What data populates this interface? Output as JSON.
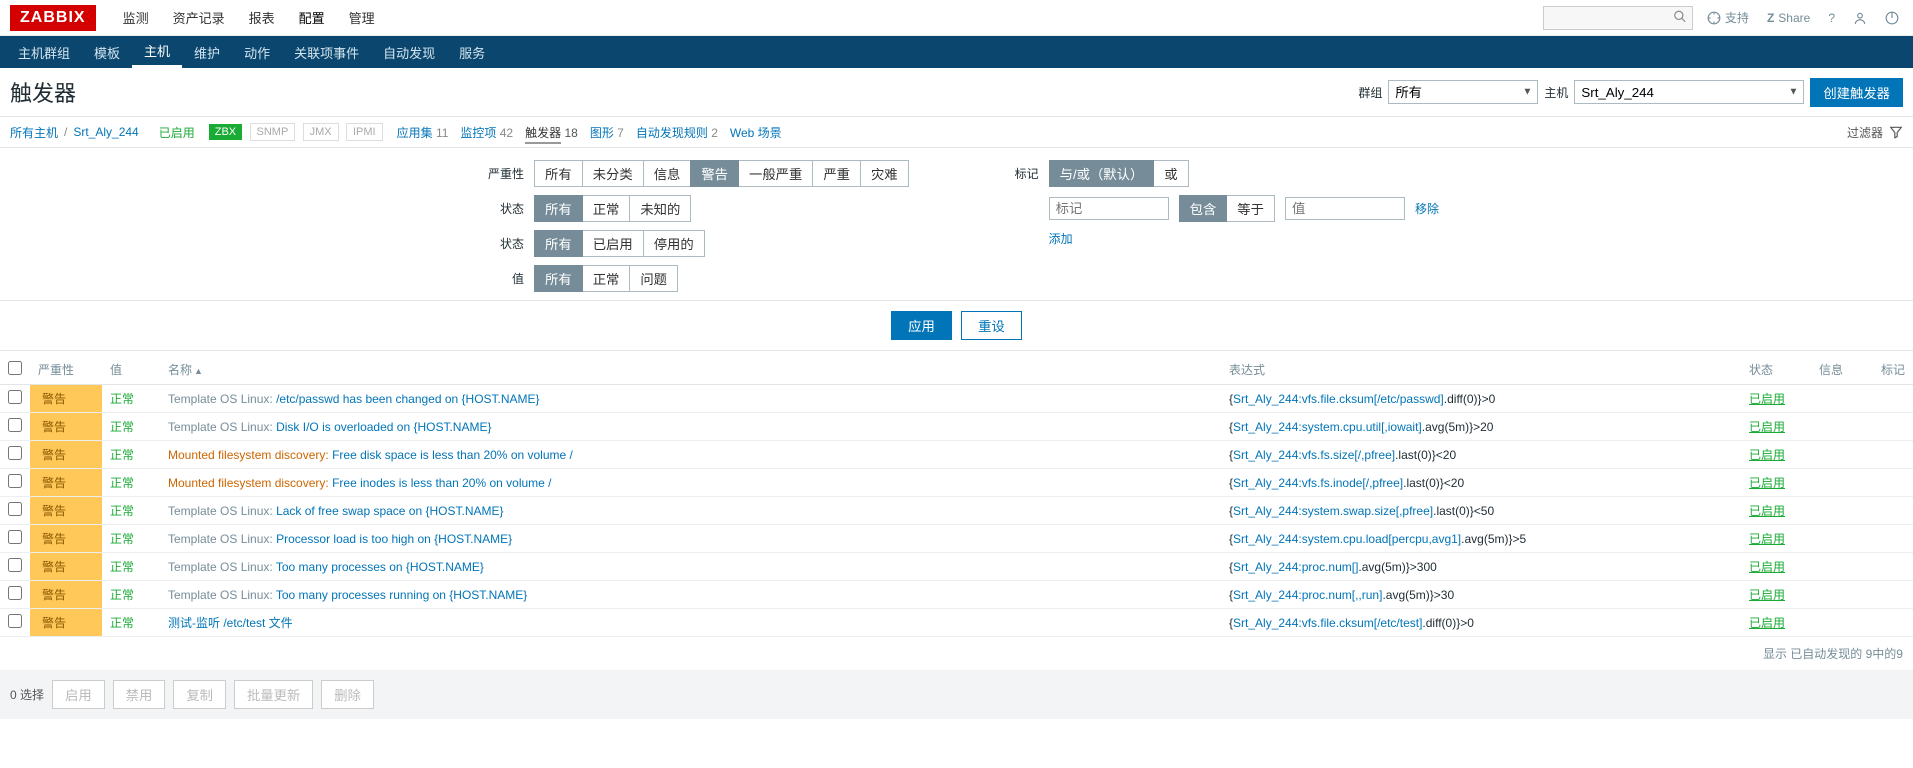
{
  "header": {
    "logo": "ZABBIX",
    "menu": [
      "监测",
      "资产记录",
      "报表",
      "配置",
      "管理"
    ],
    "menu_active_index": 3,
    "support": "支持",
    "share": "Share"
  },
  "subnav": {
    "items": [
      "主机群组",
      "模板",
      "主机",
      "维护",
      "动作",
      "关联项事件",
      "自动发现",
      "服务"
    ],
    "active_index": 2
  },
  "title": {
    "text": "触发器",
    "group_label": "群组",
    "group_value": "所有",
    "host_label": "主机",
    "host_value": "Srt_Aly_244",
    "create_btn": "创建触发器"
  },
  "crumb": {
    "all_hosts": "所有主机",
    "host": "Srt_Aly_244",
    "enabled": "已启用",
    "zbx": "ZBX",
    "snmp": "SNMP",
    "jmx": "JMX",
    "ipmi": "IPMI",
    "items": [
      {
        "label": "应用集",
        "count": "11"
      },
      {
        "label": "监控项",
        "count": "42"
      },
      {
        "label": "触发器",
        "count": "18",
        "active": true
      },
      {
        "label": "图形",
        "count": "7"
      },
      {
        "label": "自动发现规则",
        "count": "2"
      },
      {
        "label": "Web 场景",
        "count": ""
      }
    ],
    "filter_label": "过滤器"
  },
  "filter": {
    "labels": {
      "severity": "严重性",
      "state": "状态",
      "state2": "状态",
      "value": "值",
      "tags": "标记"
    },
    "severity_opts": [
      "所有",
      "未分类",
      "信息",
      "警告",
      "一般严重",
      "严重",
      "灾难"
    ],
    "severity_selected": 3,
    "state_opts": [
      "所有",
      "正常",
      "未知的"
    ],
    "state_selected": 0,
    "status_opts": [
      "所有",
      "已启用",
      "停用的"
    ],
    "status_selected": 0,
    "value_opts": [
      "所有",
      "正常",
      "问题"
    ],
    "value_selected": 0,
    "tag_mode_opts": [
      "与/或（默认）",
      "或"
    ],
    "tag_mode_selected": 0,
    "tag_placeholder": "标记",
    "tag_op_opts": [
      "包含",
      "等于"
    ],
    "tag_op_selected": 0,
    "tag_value_placeholder": "值",
    "remove": "移除",
    "add": "添加",
    "apply": "应用",
    "reset": "重设"
  },
  "table": {
    "headers": {
      "severity": "严重性",
      "value": "值",
      "name": "名称",
      "expression": "表达式",
      "status": "状态",
      "info": "信息",
      "tags": "标记"
    },
    "rows": [
      {
        "sev": "警告",
        "val": "正常",
        "prefix": "Template OS Linux: ",
        "prefix_type": "tmpl",
        "name": "/etc/passwd has been changed on {HOST.NAME}",
        "expr_pre": "{",
        "expr_link": "Srt_Aly_244:vfs.file.cksum[/etc/passwd]",
        "expr_post": ".diff(0)}>0",
        "status": "已启用"
      },
      {
        "sev": "警告",
        "val": "正常",
        "prefix": "Template OS Linux: ",
        "prefix_type": "tmpl",
        "name": "Disk I/O is overloaded on {HOST.NAME}",
        "expr_pre": "{",
        "expr_link": "Srt_Aly_244:system.cpu.util[,iowait]",
        "expr_post": ".avg(5m)}>20",
        "status": "已启用"
      },
      {
        "sev": "警告",
        "val": "正常",
        "prefix": "Mounted filesystem discovery: ",
        "prefix_type": "disc",
        "name": "Free disk space is less than 20% on volume /",
        "expr_pre": "{",
        "expr_link": "Srt_Aly_244:vfs.fs.size[/,pfree]",
        "expr_post": ".last(0)}<20",
        "status": "已启用"
      },
      {
        "sev": "警告",
        "val": "正常",
        "prefix": "Mounted filesystem discovery: ",
        "prefix_type": "disc",
        "name": "Free inodes is less than 20% on volume /",
        "expr_pre": "{",
        "expr_link": "Srt_Aly_244:vfs.fs.inode[/,pfree]",
        "expr_post": ".last(0)}<20",
        "status": "已启用"
      },
      {
        "sev": "警告",
        "val": "正常",
        "prefix": "Template OS Linux: ",
        "prefix_type": "tmpl",
        "name": "Lack of free swap space on {HOST.NAME}",
        "expr_pre": "{",
        "expr_link": "Srt_Aly_244:system.swap.size[,pfree]",
        "expr_post": ".last(0)}<50",
        "status": "已启用"
      },
      {
        "sev": "警告",
        "val": "正常",
        "prefix": "Template OS Linux: ",
        "prefix_type": "tmpl",
        "name": "Processor load is too high on {HOST.NAME}",
        "expr_pre": "{",
        "expr_link": "Srt_Aly_244:system.cpu.load[percpu,avg1]",
        "expr_post": ".avg(5m)}>5",
        "status": "已启用"
      },
      {
        "sev": "警告",
        "val": "正常",
        "prefix": "Template OS Linux: ",
        "prefix_type": "tmpl",
        "name": "Too many processes on {HOST.NAME}",
        "expr_pre": "{",
        "expr_link": "Srt_Aly_244:proc.num[]",
        "expr_post": ".avg(5m)}>300",
        "status": "已启用"
      },
      {
        "sev": "警告",
        "val": "正常",
        "prefix": "Template OS Linux: ",
        "prefix_type": "tmpl",
        "name": "Too many processes running on {HOST.NAME}",
        "expr_pre": "{",
        "expr_link": "Srt_Aly_244:proc.num[,,run]",
        "expr_post": ".avg(5m)}>30",
        "status": "已启用"
      },
      {
        "sev": "警告",
        "val": "正常",
        "prefix": "",
        "prefix_type": "",
        "name": "测试-监听 /etc/test 文件",
        "expr_pre": "{",
        "expr_link": "Srt_Aly_244:vfs.file.cksum[/etc/test]",
        "expr_post": ".diff(0)}>0",
        "status": "已启用"
      }
    ],
    "footer": "显示 已自动发现的 9中的9"
  },
  "bottom": {
    "selected": "0 选择",
    "enable": "启用",
    "disable": "禁用",
    "copy": "复制",
    "massupdate": "批量更新",
    "delete": "删除"
  }
}
